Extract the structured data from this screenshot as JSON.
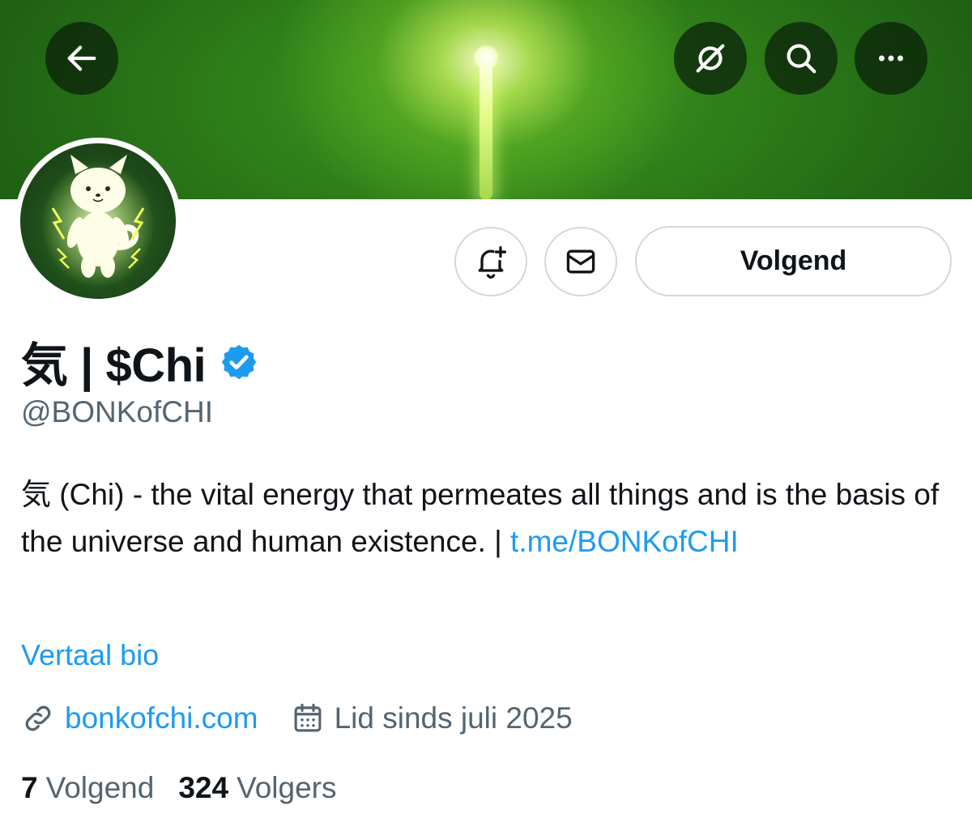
{
  "header": {
    "back_icon": "arrow-left-icon",
    "grok_icon": "grok-icon",
    "search_icon": "search-icon",
    "more_icon": "more-horizontal-icon"
  },
  "profile": {
    "display_name": "気 | $Chi",
    "verified": true,
    "handle": "@BONKofCHI",
    "bio_text": "気 (Chi) - the vital energy that permeates all things and is the basis of the universe and human existence. | ",
    "bio_link_text": "t.me/BONKofCHI",
    "translate_label": "Vertaal bio",
    "website": "bonkofchi.com",
    "joined": "Lid sinds juli 2025",
    "following_count": "7",
    "following_label": "Volgend",
    "followers_count": "324",
    "followers_label": "Volgers"
  },
  "actions": {
    "notify_icon": "bell-plus-icon",
    "message_icon": "envelope-icon",
    "follow_label": "Volgend"
  },
  "colors": {
    "accent": "#1d9bf0",
    "text": "#0f1419",
    "secondary_text": "#536471",
    "border": "#cfd9de",
    "banner_green": "#2f7f1a"
  }
}
